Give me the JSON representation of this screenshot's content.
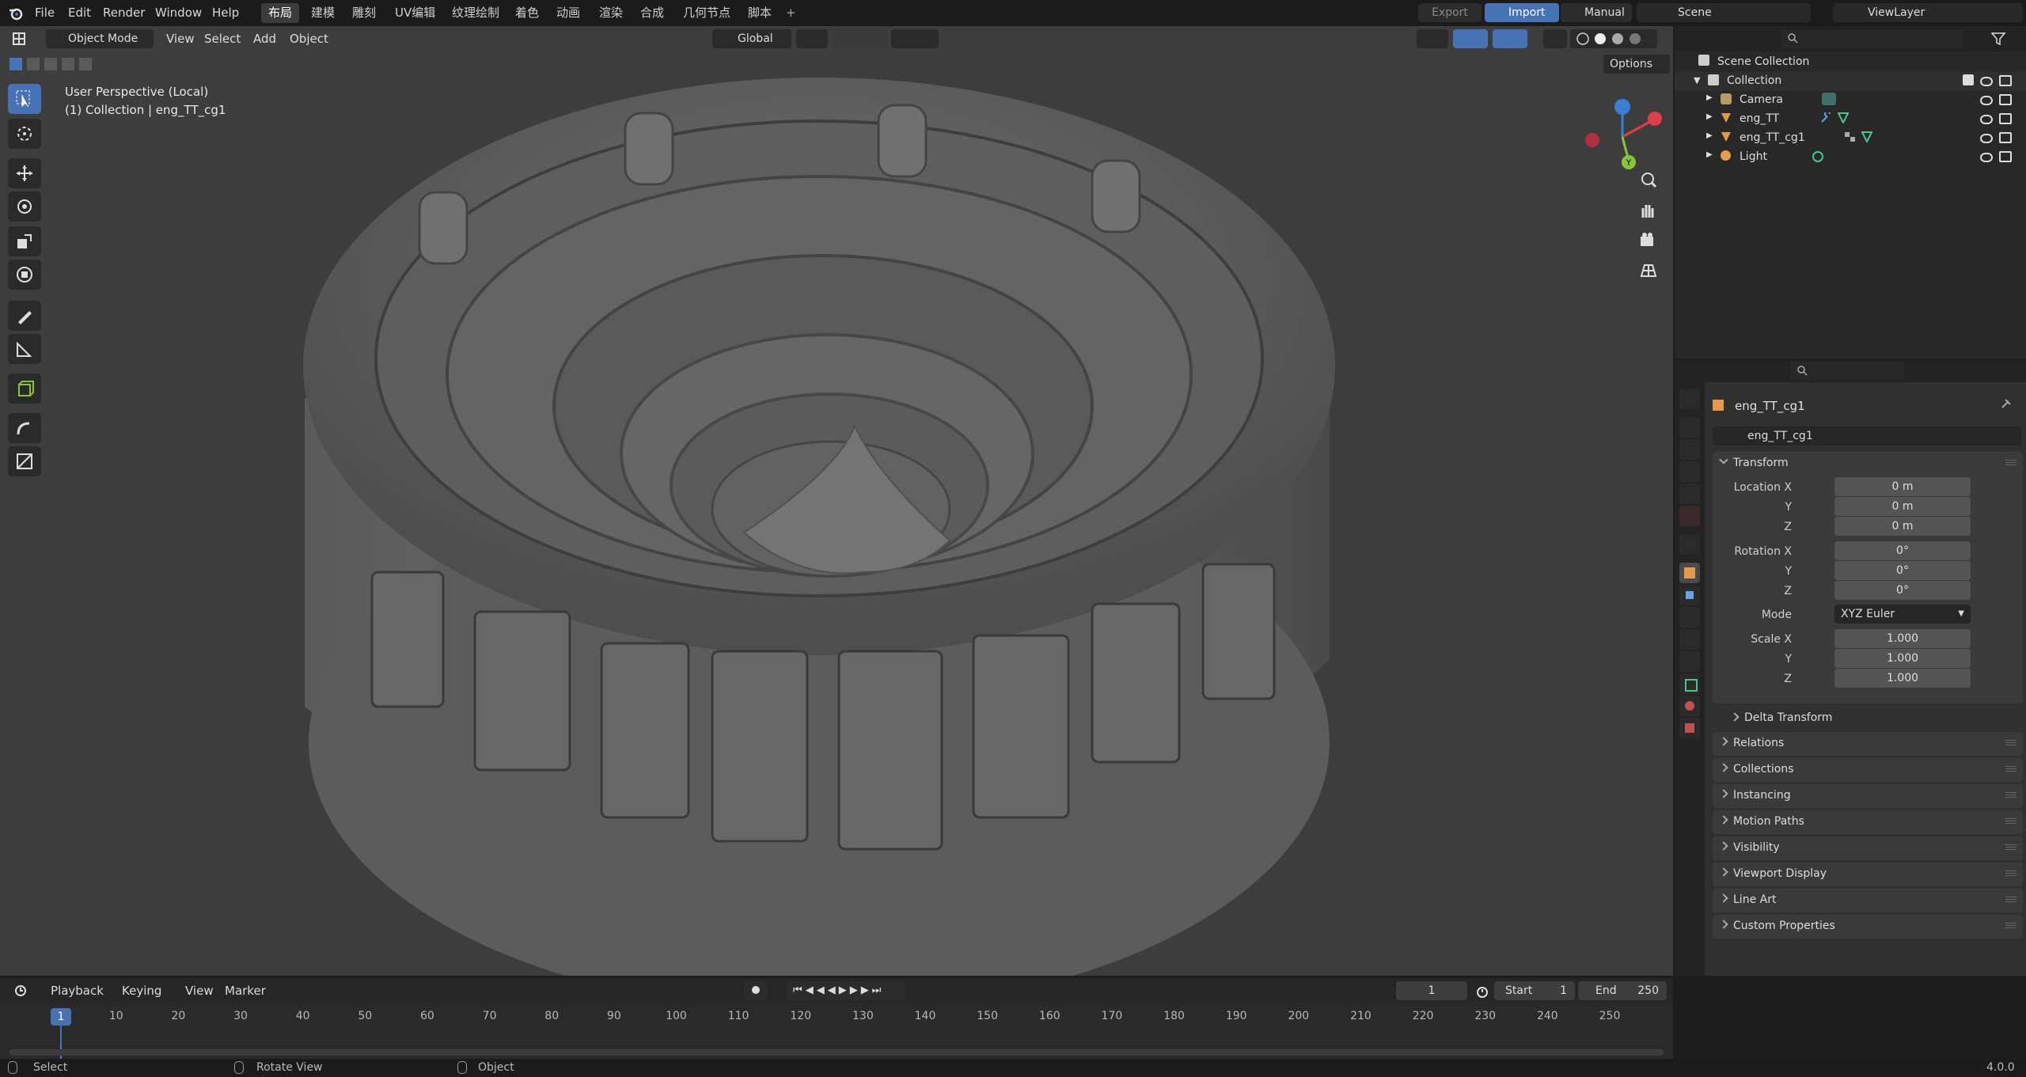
{
  "topbar": {
    "menu": [
      "File",
      "Edit",
      "Render",
      "Window",
      "Help"
    ],
    "workspaces": [
      "布局",
      "建模",
      "雕刻",
      "UV编辑",
      "纹理绘制",
      "着色",
      "动画",
      "渲染",
      "合成",
      "几何节点",
      "脚本"
    ],
    "active_workspace": "布局",
    "add_tab": "+",
    "export_label": "Export",
    "import_label": "Import",
    "manual_label": "Manual",
    "scene_label": "Scene",
    "viewlayer_label": "ViewLayer"
  },
  "viewport": {
    "mode_label": "Object Mode",
    "menus": [
      "View",
      "Select",
      "Add",
      "Object"
    ],
    "transform_orientation": "Global",
    "options_label": "Options",
    "overlay_line1": "User Perspective (Local)",
    "overlay_line2": "(1) Collection | eng_TT_cg1",
    "gizmo_y": "Y"
  },
  "outliner": {
    "root": "Scene Collection",
    "collection": "Collection",
    "items": [
      {
        "name": "Camera",
        "icon": "camera-icon",
        "color": "#b89a6b"
      },
      {
        "name": "eng_TT",
        "icon": "mesh-icon",
        "color": "#e59a4a"
      },
      {
        "name": "eng_TT_cg1",
        "icon": "mesh-icon",
        "color": "#e59a4a"
      },
      {
        "name": "Light",
        "icon": "light-icon",
        "color": "#e5a04a"
      }
    ]
  },
  "properties": {
    "object_name": "eng_TT_cg1",
    "data_name": "eng_TT_cg1",
    "transform_label": "Transform",
    "location_label": "Location X",
    "rotation_label": "Rotation X",
    "scale_label": "Scale X",
    "y_label": "Y",
    "z_label": "Z",
    "location": [
      "0 m",
      "0 m",
      "0 m"
    ],
    "rotation": [
      "0°",
      "0°",
      "0°"
    ],
    "mode_label": "Mode",
    "mode_value": "XYZ Euler",
    "scale": [
      "1.000",
      "1.000",
      "1.000"
    ],
    "delta_transform": "Delta Transform",
    "panels": [
      "Relations",
      "Collections",
      "Instancing",
      "Motion Paths",
      "Visibility",
      "Viewport Display",
      "Line Art",
      "Custom Properties"
    ]
  },
  "timeline": {
    "menus": [
      "Playback",
      "Keying",
      "View",
      "Marker"
    ],
    "current_frame": "1",
    "start_label": "Start",
    "start_value": "1",
    "end_label": "End",
    "end_value": "250",
    "ticks": [
      "1",
      "10",
      "20",
      "30",
      "40",
      "50",
      "60",
      "70",
      "80",
      "90",
      "100",
      "110",
      "120",
      "130",
      "140",
      "150",
      "160",
      "170",
      "180",
      "190",
      "200",
      "210",
      "220",
      "230",
      "240",
      "250"
    ]
  },
  "statusbar": {
    "select": "Select",
    "rotate_view": "Rotate View",
    "object": "Object",
    "version": "4.0.0"
  },
  "colors": {
    "accent": "#4772b3",
    "viewport_bg": "#3d3d3d",
    "panel_bg": "#303030",
    "axis_x": "#e03c4a",
    "axis_y": "#8ac43a",
    "axis_z": "#3a7fd4"
  }
}
